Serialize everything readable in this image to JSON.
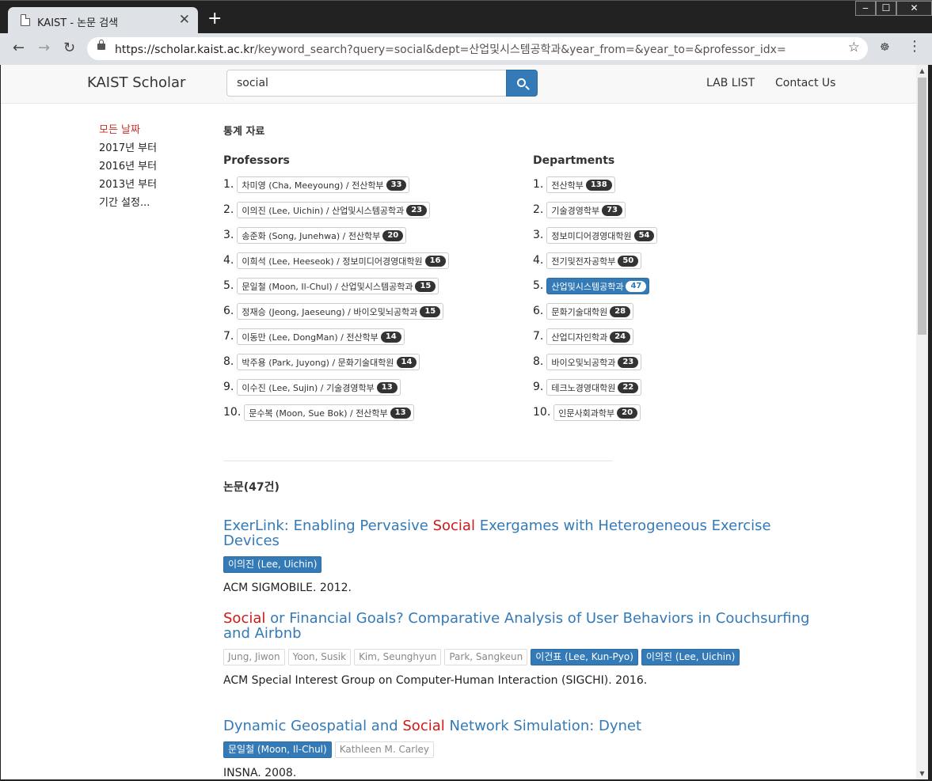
{
  "browser": {
    "tab_title": "KAIST - 논문 검색",
    "tab_close": "✕",
    "new_tab": "+",
    "url_host": "https://scholar.kaist.ac.kr",
    "url_path": "/keyword_search?query=social&dept=산업및시스템공학과&year_from=&year_to=&professor_idx=",
    "controls": {
      "minimize": "‒",
      "maximize": "☐",
      "close": "✕"
    },
    "icons": {
      "back": "arrow-left-icon",
      "forward": "arrow-right-icon",
      "reload": "reload-icon",
      "star": "star-icon",
      "menu": "kebab-menu-icon"
    }
  },
  "navbar": {
    "brand": "KAIST Scholar",
    "search_value": "social",
    "links": [
      "LAB LIST",
      "Contact Us"
    ]
  },
  "filter": {
    "items": [
      "모든 날짜",
      "2017년 부터",
      "2016년 부터",
      "2013년 부터",
      "기간 설정..."
    ],
    "active_index": 0
  },
  "stats": {
    "heading": "통계 자료",
    "professors_heading": "Professors",
    "departments_heading": "Departments",
    "professors": [
      {
        "rank": "1.",
        "label": "차미영 (Cha, Meeyoung) / 전산학부",
        "count": "33"
      },
      {
        "rank": "2.",
        "label": "이의진 (Lee, Uichin) / 산업및시스템공학과",
        "count": "23"
      },
      {
        "rank": "3.",
        "label": "송준화 (Song, Junehwa) / 전산학부",
        "count": "20"
      },
      {
        "rank": "4.",
        "label": "이희석 (Lee, Heeseok) / 정보미디어경영대학원",
        "count": "16"
      },
      {
        "rank": "5.",
        "label": "문일철 (Moon, Il-Chul) / 산업및시스템공학과",
        "count": "15"
      },
      {
        "rank": "6.",
        "label": "정재승 (Jeong, Jaeseung) / 바이오및뇌공학과",
        "count": "15"
      },
      {
        "rank": "7.",
        "label": "이동만 (Lee, DongMan) / 전산학부",
        "count": "14"
      },
      {
        "rank": "8.",
        "label": "박주용 (Park, Juyong) / 문화기술대학원",
        "count": "14"
      },
      {
        "rank": "9.",
        "label": "이수진 (Lee, Sujin) / 기술경영학부",
        "count": "13"
      },
      {
        "rank": "10.",
        "label": "문수복 (Moon, Sue Bok) / 전산학부",
        "count": "13"
      }
    ],
    "departments": [
      {
        "rank": "1.",
        "label": "전산학부",
        "count": "138"
      },
      {
        "rank": "2.",
        "label": "기술경영학부",
        "count": "73"
      },
      {
        "rank": "3.",
        "label": "정보미디어경영대학원",
        "count": "54"
      },
      {
        "rank": "4.",
        "label": "전기및전자공학부",
        "count": "50"
      },
      {
        "rank": "5.",
        "label": "산업및시스템공학과",
        "count": "47",
        "selected": true
      },
      {
        "rank": "6.",
        "label": "문화기술대학원",
        "count": "28"
      },
      {
        "rank": "7.",
        "label": "산업디자인학과",
        "count": "24"
      },
      {
        "rank": "8.",
        "label": "바이오및뇌공학과",
        "count": "23"
      },
      {
        "rank": "9.",
        "label": "테크노경영대학원",
        "count": "22"
      },
      {
        "rank": "10.",
        "label": "인문사회과학부",
        "count": "20"
      }
    ]
  },
  "papers": {
    "heading": "논문(47건)",
    "items": [
      {
        "title_parts": [
          [
            "ExerLink: Enabling Pervasive ",
            false
          ],
          [
            "Social",
            true
          ],
          [
            " Exergames with Heterogeneous Exercise Devices",
            false
          ]
        ],
        "authors": [
          {
            "name": "이의진 (Lee, Uichin)",
            "lab": true
          }
        ],
        "venue": "ACM SIGMOBILE. 2012."
      },
      {
        "title_parts": [
          [
            "Social",
            true
          ],
          [
            " or Financial Goals? Comparative Analysis of User Behaviors in Couchsurfing and Airbnb",
            false
          ]
        ],
        "authors": [
          {
            "name": "Jung, Jiwon",
            "lab": false
          },
          {
            "name": "Yoon, Susik",
            "lab": false
          },
          {
            "name": "Kim, Seunghyun",
            "lab": false
          },
          {
            "name": "Park, Sangkeun",
            "lab": false
          },
          {
            "name": "이건표 (Lee, Kun-Pyo)",
            "lab": true
          },
          {
            "name": "이의진 (Lee, Uichin)",
            "lab": true
          }
        ],
        "venue": "ACM Special Interest Group on Computer-Human Interaction (SIGCHI). 2016."
      },
      {
        "title_parts": [
          [
            "Dynamic Geospatial and ",
            false
          ],
          [
            "Social",
            true
          ],
          [
            " Network Simulation: Dynet",
            false
          ]
        ],
        "authors": [
          {
            "name": "문일철 (Moon, Il-Chul)",
            "lab": true
          },
          {
            "name": "Kathleen M. Carley",
            "lab": false
          }
        ],
        "venue": "INSNA. 2008."
      }
    ]
  },
  "colors": {
    "link": "#337ab7",
    "highlight": "#d01818",
    "active_filter": "#c9302c"
  }
}
